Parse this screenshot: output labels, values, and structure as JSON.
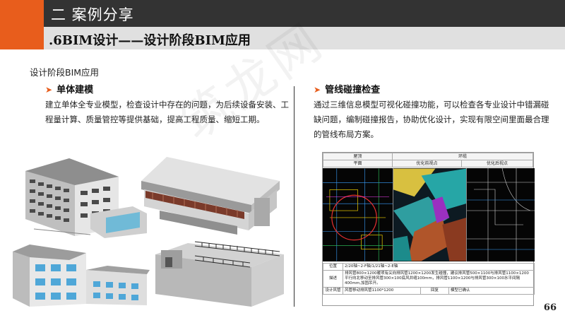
{
  "header": {
    "chapter_title": "二 案例分享",
    "section_title": ".6BIM设计——设计阶段BIM应用"
  },
  "section_label": "设计阶段BIM应用",
  "left_column": {
    "heading": "单体建模",
    "body": "建立单体全专业模型，检查设计中存在的问题，为后续设备安装、工程量计算、质量管控等提供基础，提高工程质量、缩短工期。"
  },
  "right_column": {
    "heading": "管线碰撞检查",
    "body": "通过三维信息模型可视化碰撞功能，可以检查各专业设计中错漏碰缺问题，编制碰撞报告，协助优化设计，实现有限空间里面最合理的管线布局方案。"
  },
  "clash_report": {
    "col_1": "屋顶",
    "col_2": "环缆",
    "sub_1": "平面",
    "sub_2": "优化前视点",
    "sub_3": "优化后视点",
    "position_label": "位置",
    "position_value": "2/20轴~2-F轴/1/21轴~2-E轴",
    "desc_label": "描述",
    "desc_value": "排风管800×1200暖项有尖向排风管1200×1200发生碰撞，建议排风管500×1100与排风管1100×1200平行向北移动至排风管300×100底风井缝100mm，排风管1100×1200与排风管300×100水平间隔400mm,加固吊开。",
    "design_label": "设计风管",
    "design_value": "风管移动排风管1100*1200",
    "confirm_label": "回复",
    "confirm_value": "模型已确认"
  },
  "page_number": "66",
  "colors": {
    "accent": "#e85d1c",
    "header_dark": "#333333",
    "subheader_bg": "#e0e0e0"
  }
}
